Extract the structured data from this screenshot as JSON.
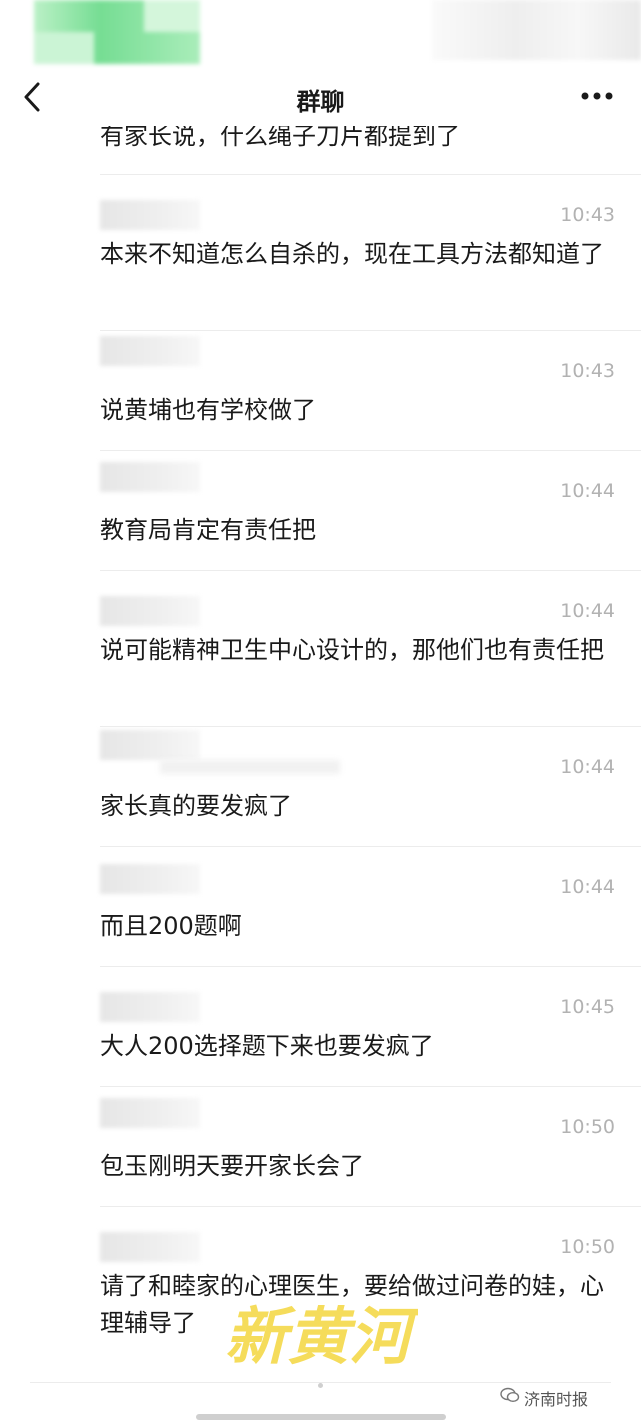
{
  "header": {
    "title": "群聊",
    "back_icon": "chevron-left-icon",
    "more_icon": "more-dots-icon"
  },
  "partial_message": {
    "text": "有家长说，什么绳子刀片都提到了"
  },
  "messages": [
    {
      "time": "10:43",
      "text": "本来不知道怎么自杀的，现在工具方法都知道了"
    },
    {
      "time": "10:43",
      "text": "说黄埔也有学校做了"
    },
    {
      "time": "10:44",
      "text": "教育局肯定有责任把"
    },
    {
      "time": "10:44",
      "text": "说可能精神卫生中心设计的，那他们也有责任把"
    },
    {
      "time": "10:44",
      "text": "家长真的要发疯了"
    },
    {
      "time": "10:44",
      "text": "而且200题啊"
    },
    {
      "time": "10:45",
      "text": "大人200选择题下来也要发疯了"
    },
    {
      "time": "10:50",
      "text": "包玉刚明天要开家长会了"
    },
    {
      "time": "10:50",
      "text": "请了和睦家的心理医生，要给做过问卷的娃，心理辅导了"
    }
  ],
  "watermark": {
    "logo_text": "新黄河",
    "source_label": "济南时报",
    "logo_color": "#f5d94a"
  }
}
